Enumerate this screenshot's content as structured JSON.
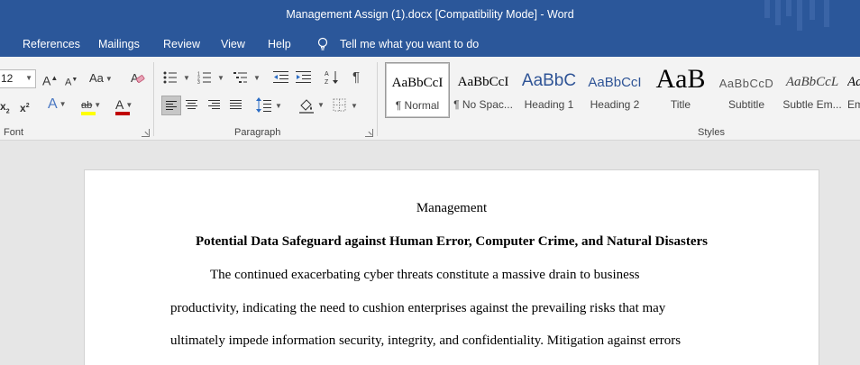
{
  "window": {
    "title": "Management Assign (1).docx [Compatibility Mode]  -  Word"
  },
  "menu": {
    "tabs": [
      "References",
      "Mailings",
      "Review",
      "View",
      "Help"
    ],
    "tell_me": "Tell me what you want to do"
  },
  "font_group": {
    "label": "Font",
    "size_value": "12",
    "grow_icon": "A",
    "shrink_icon": "A",
    "change_case": "Aa",
    "subscript": "x",
    "superscript": "x",
    "subscript_mark": "2",
    "superscript_mark": "2",
    "text_effects": "A",
    "highlight": "ab",
    "font_color": "A",
    "highlight_color": "#ffff00",
    "font_color_value": "#c00000"
  },
  "paragraph_group": {
    "label": "Paragraph"
  },
  "styles_group": {
    "label": "Styles",
    "items": [
      {
        "sample": "AaBbCcI",
        "label": "¶ Normal"
      },
      {
        "sample": "AaBbCcI",
        "label": "¶ No Spac..."
      },
      {
        "sample": "AaBbC",
        "label": "Heading 1"
      },
      {
        "sample": "AaBbCcI",
        "label": "Heading 2"
      },
      {
        "sample": "AaB",
        "label": "Title"
      },
      {
        "sample": "AaBbCcD",
        "label": "Subtitle"
      },
      {
        "sample": "AaBbCcL",
        "label": "Subtle Em..."
      },
      {
        "sample": "Aa",
        "label": "Em"
      }
    ]
  },
  "document": {
    "header": "Management",
    "title": "Potential Data Safeguard against Human Error, Computer Crime, and Natural Disasters",
    "lines": [
      "The continued exacerbating cyber threats constitute a massive drain to business",
      "productivity, indicating the need to cushion enterprises against the prevailing risks that may",
      "ultimately impede information security, integrity, and confidentiality. Mitigation against errors"
    ]
  },
  "colors": {
    "brand": "#2b579a",
    "ribbon": "#f3f3f3",
    "canvas": "#e6e6e6"
  }
}
